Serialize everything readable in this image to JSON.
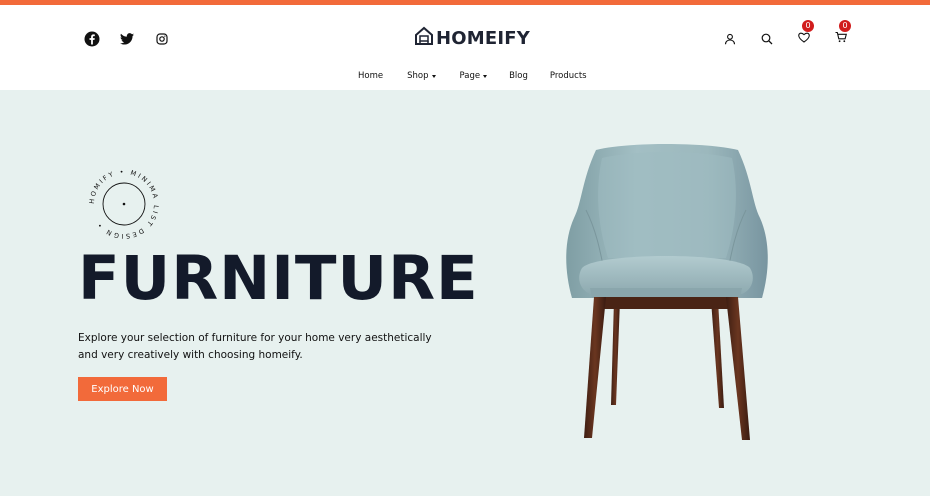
{
  "brand": {
    "name": "HOMEIFY",
    "accent": "#f26a3a",
    "hero_bg": "#e7f1ef",
    "badge_color": "#d11d1d"
  },
  "social": [
    {
      "icon": "facebook-icon"
    },
    {
      "icon": "twitter-icon"
    },
    {
      "icon": "instagram-icon"
    }
  ],
  "actions": {
    "account_icon": "user-icon",
    "search_icon": "search-icon",
    "wishlist": {
      "icon": "heart-icon",
      "count": "0"
    },
    "cart": {
      "icon": "cart-icon",
      "count": "0"
    }
  },
  "nav": {
    "items": [
      {
        "label": "Home",
        "dropdown": false
      },
      {
        "label": "Shop",
        "dropdown": true
      },
      {
        "label": "Page",
        "dropdown": true
      },
      {
        "label": "Blog",
        "dropdown": false
      },
      {
        "label": "Products",
        "dropdown": false
      }
    ]
  },
  "hero": {
    "stamp_text": "HOMIFY • MINIMA LIST DESIGN •",
    "headline": "FURNITURE",
    "description": "Explore your selection of furniture for your home very aesthetically and very creatively with choosing homeify.",
    "cta_label": "Explore Now",
    "image": "armchair-image"
  }
}
